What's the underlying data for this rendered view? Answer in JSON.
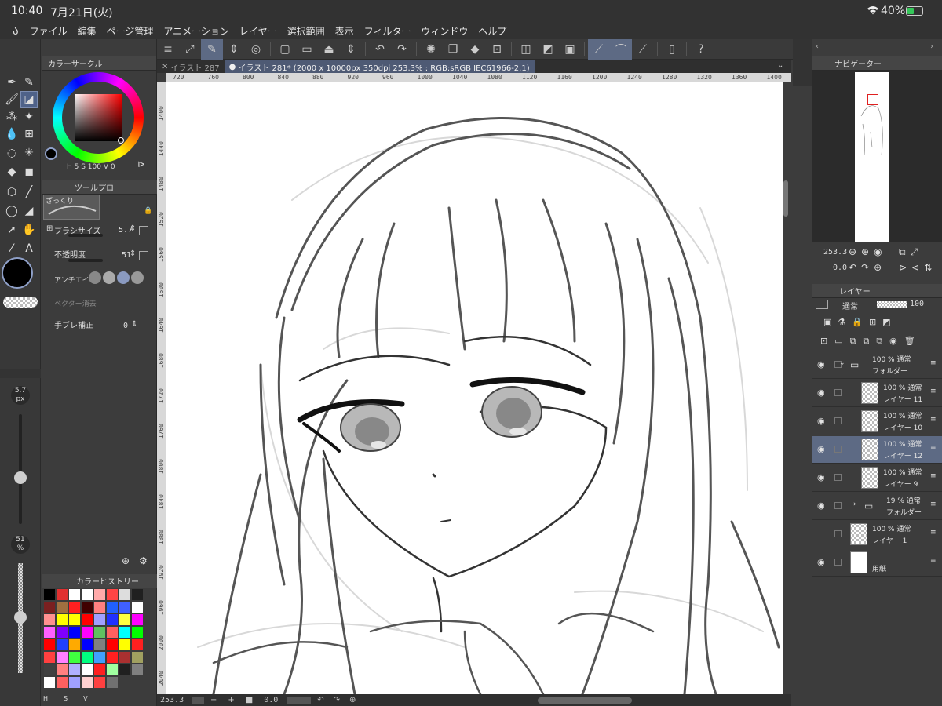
{
  "status": {
    "time": "10:40",
    "date": "7月21日(火)",
    "battery": "40%"
  },
  "menu": [
    "ファイル",
    "編集",
    "ページ管理",
    "アニメーション",
    "レイヤー",
    "選択範囲",
    "表示",
    "フィルター",
    "ウィンドウ",
    "ヘルプ"
  ],
  "tabs": {
    "inactive": "イラスト 287",
    "active": "イラスト 281* (2000 x 10000px 350dpi 253.3% : RGB:sRGB IEC61966-2.1)"
  },
  "ruler_h": [
    "720",
    "760",
    "800",
    "840",
    "880",
    "920",
    "960",
    "1000",
    "1040",
    "1080",
    "1120",
    "1160",
    "1200",
    "1240",
    "1280",
    "1320",
    "1360",
    "1400"
  ],
  "ruler_v": [
    "1400",
    "1440",
    "1480",
    "1520",
    "1560",
    "1600",
    "1640",
    "1680",
    "1720",
    "1760",
    "1800",
    "1840",
    "1880",
    "1920",
    "1960",
    "2000",
    "2040"
  ],
  "colorcircle": {
    "title": "カラーサークル",
    "hsv": "H 5 S 100 V 0"
  },
  "toolprop": {
    "title": "ツールプロ",
    "preset": "ざっくり",
    "brush_size_label": "ブラシサイズ",
    "brush_size": "5.7",
    "opacity_label": "不透明度",
    "opacity": "51",
    "antialias_label": "アンチエイリ",
    "vector_label": "ベクター消去",
    "stabilize_label": "手ブレ補正",
    "stabilize": "0"
  },
  "sidebar_size": {
    "value": "5.7",
    "unit": "px",
    "opacity": "51",
    "opacity_unit": "%",
    "size_level": 0.42,
    "opacity_level": 0.51
  },
  "history": {
    "title": "カラーヒストリー",
    "colors": [
      "#000000",
      "#e03030",
      "#ffffff",
      "#ffffff",
      "#ffaaaa",
      "#ff4444",
      "#dddddd",
      "#202020",
      "#7a2020",
      "#a07040",
      "#ff2020",
      "#400000",
      "#ff8080",
      "#2060ff",
      "#4060ff",
      "#ffffff",
      "#ff9090",
      "#ffff00",
      "#ffff00",
      "#ff0000",
      "#a0a0ff",
      "#2030ff",
      "#ffff40",
      "#ff00ff",
      "#ff60ff",
      "#8000ff",
      "#0000ff",
      "#ff00ff",
      "#60c060",
      "#ff6060",
      "#00ffff",
      "#00ff00",
      "#ff0000",
      "#2040ff",
      "#ffaa00",
      "#0000ff",
      "#808080",
      "#ff0000",
      "#ffff00",
      "#ff2020",
      "#ff4040",
      "#ff80ff",
      "#40ff40",
      "#00ff80",
      "#40a0ff",
      "#ff2020",
      "#aa3030",
      "#a0a060",
      "#404040",
      "#ff8080",
      "#b0b0ff",
      "#ffffff",
      "#ff2020",
      "#a0ffa0",
      "#202020",
      "#808080",
      "#ffffff",
      "#ff6060",
      "#a0a0ff",
      "#ffd0d0",
      "#ff4040",
      "#707070"
    ],
    "hsv_labels": [
      "H",
      "S",
      "V"
    ]
  },
  "navigator": {
    "title": "ナビゲーター",
    "zoom": "253.3",
    "angle": "0.0"
  },
  "layers": {
    "title": "レイヤー",
    "blend": "通常",
    "opacity": "100",
    "items": [
      {
        "pct": "100 %",
        "mode": "通常",
        "name": "フォルダー"
      },
      {
        "pct": "100 %",
        "mode": "通常",
        "name": "レイヤー 11"
      },
      {
        "pct": "100 %",
        "mode": "通常",
        "name": "レイヤー 10"
      },
      {
        "pct": "100 %",
        "mode": "通常",
        "name": "レイヤー 12"
      },
      {
        "pct": "100 %",
        "mode": "通常",
        "name": "レイヤー 9"
      },
      {
        "pct": "19 %",
        "mode": "通常",
        "name": "フォルダー"
      },
      {
        "pct": "100 %",
        "mode": "通常",
        "name": "レイヤー 1"
      },
      {
        "pct": "",
        "mode": "",
        "name": "用紙"
      }
    ]
  },
  "bottom": {
    "zoom": "253.3",
    "angle": "0.0"
  },
  "colors": {
    "accent": "#5d6a84",
    "panel": "#3c3c3c",
    "canvas": "#ffffff"
  }
}
